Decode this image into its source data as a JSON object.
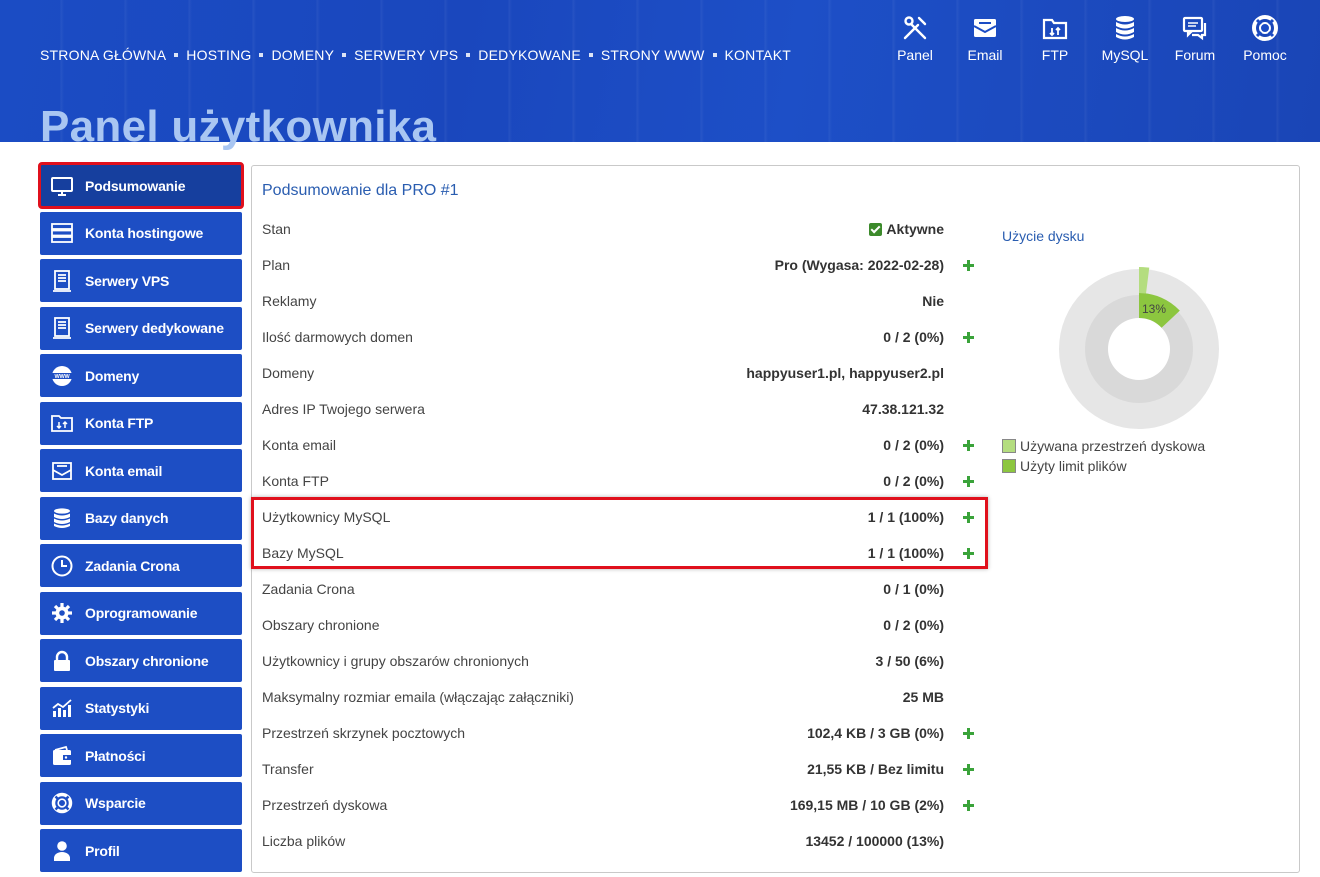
{
  "topnav": {
    "items": [
      "STRONA GŁÓWNA",
      "HOSTING",
      "DOMENY",
      "SERWERY VPS",
      "DEDYKOWANE",
      "STRONY WWW",
      "KONTAKT"
    ]
  },
  "quicklinks": [
    {
      "label": "Panel",
      "icon": "tools-icon"
    },
    {
      "label": "Email",
      "icon": "email-icon"
    },
    {
      "label": "FTP",
      "icon": "ftp-folder-icon"
    },
    {
      "label": "MySQL",
      "icon": "database-icon"
    },
    {
      "label": "Forum",
      "icon": "forum-icon"
    },
    {
      "label": "Pomoc",
      "icon": "lifebuoy-icon"
    }
  ],
  "page_title": "Panel użytkownika",
  "sidebar": {
    "items": [
      {
        "label": "Podsumowanie",
        "icon": "monitor-icon",
        "active": true
      },
      {
        "label": "Konta hostingowe",
        "icon": "server-rack-icon"
      },
      {
        "label": "Serwery VPS",
        "icon": "server-icon"
      },
      {
        "label": "Serwery dedykowane",
        "icon": "server-icon"
      },
      {
        "label": "Domeny",
        "icon": "www-globe-icon"
      },
      {
        "label": "Konta FTP",
        "icon": "ftp-folder-icon"
      },
      {
        "label": "Konta email",
        "icon": "email-icon"
      },
      {
        "label": "Bazy danych",
        "icon": "database-icon"
      },
      {
        "label": "Zadania Crona",
        "icon": "clock-icon"
      },
      {
        "label": "Oprogramowanie",
        "icon": "gear-icon"
      },
      {
        "label": "Obszary chronione",
        "icon": "lock-icon"
      },
      {
        "label": "Statystyki",
        "icon": "stats-chart-icon"
      },
      {
        "label": "Płatności",
        "icon": "wallet-icon"
      },
      {
        "label": "Wsparcie",
        "icon": "lifebuoy-icon"
      },
      {
        "label": "Profil",
        "icon": "user-icon"
      }
    ]
  },
  "summary": {
    "title": "Podsumowanie dla PRO #1",
    "rows": [
      {
        "label": "Stan",
        "value": "Aktywne",
        "check": true,
        "plus": false
      },
      {
        "label": "Plan",
        "value": "Pro (Wygasa: 2022-02-28)",
        "plus": true
      },
      {
        "label": "Reklamy",
        "value": "Nie",
        "plus": false
      },
      {
        "label": "Ilość darmowych domen",
        "value": "0 / 2 (0%)",
        "plus": true
      },
      {
        "label": "Domeny",
        "value": "happyuser1.pl, happyuser2.pl",
        "plus": false
      },
      {
        "label": "Adres IP Twojego serwera",
        "value": "47.38.121.32",
        "plus": false
      },
      {
        "label": "Konta email",
        "value": "0 / 2 (0%)",
        "plus": true
      },
      {
        "label": "Konta FTP",
        "value": "0 / 2 (0%)",
        "plus": true
      },
      {
        "label": "Użytkownicy MySQL",
        "value": "1 / 1 (100%)",
        "plus": true
      },
      {
        "label": "Bazy MySQL",
        "value": "1 / 1 (100%)",
        "plus": true
      },
      {
        "label": "Zadania Crona",
        "value": "0 / 1 (0%)",
        "plus": false
      },
      {
        "label": "Obszary chronione",
        "value": "0 / 2 (0%)",
        "plus": false
      },
      {
        "label": "Użytkownicy i grupy obszarów chronionych",
        "value": "3 / 50 (6%)",
        "plus": false
      },
      {
        "label": "Maksymalny rozmiar emaila (włączając załączniki)",
        "value": "25 MB",
        "plus": false
      },
      {
        "label": "Przestrzeń skrzynek pocztowych",
        "value": "102,4 KB / 3 GB (0%)",
        "plus": true
      },
      {
        "label": "Transfer",
        "value": "21,55 KB / Bez limitu",
        "plus": true
      },
      {
        "label": "Przestrzeń dyskowa",
        "value": "169,15 MB / 10 GB (2%)",
        "plus": true
      },
      {
        "label": "Liczba plików",
        "value": "13452 / 100000 (13%)",
        "plus": false
      }
    ]
  },
  "disk_chart": {
    "title": "Użycie dysku",
    "label": "13%",
    "disk_used_fraction": 0.02,
    "files_used_fraction": 0.13,
    "legend": [
      "Używana przestrzeń dyskowa",
      "Użyty limit plików"
    ],
    "colors": {
      "disk": "#b4dd7f",
      "files": "#8cc63f",
      "track_outer": "#e6e6e6",
      "track_inner": "#d9d9d9"
    }
  },
  "colors": {
    "accent": "#1d4ec4",
    "highlight": "#e0101c",
    "plus": "#3aa33a",
    "link": "#2a5db0"
  }
}
